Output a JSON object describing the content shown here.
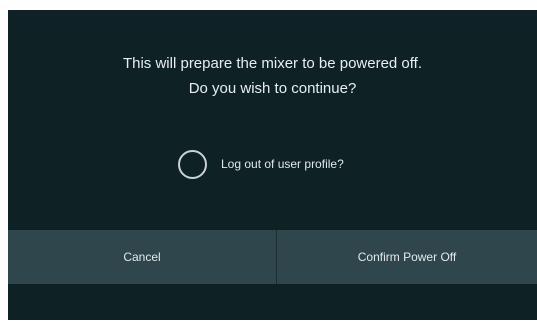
{
  "dialog": {
    "message_line1": "This will prepare the mixer to be powered off.",
    "message_line2": "Do you wish to continue?",
    "logout_option": {
      "label": "Log out of user profile?",
      "checked": false
    },
    "buttons": {
      "cancel": "Cancel",
      "confirm": "Confirm Power Off"
    }
  },
  "colors": {
    "background": "#0e2226",
    "button": "#2f464c",
    "text": "#e8eef0"
  }
}
